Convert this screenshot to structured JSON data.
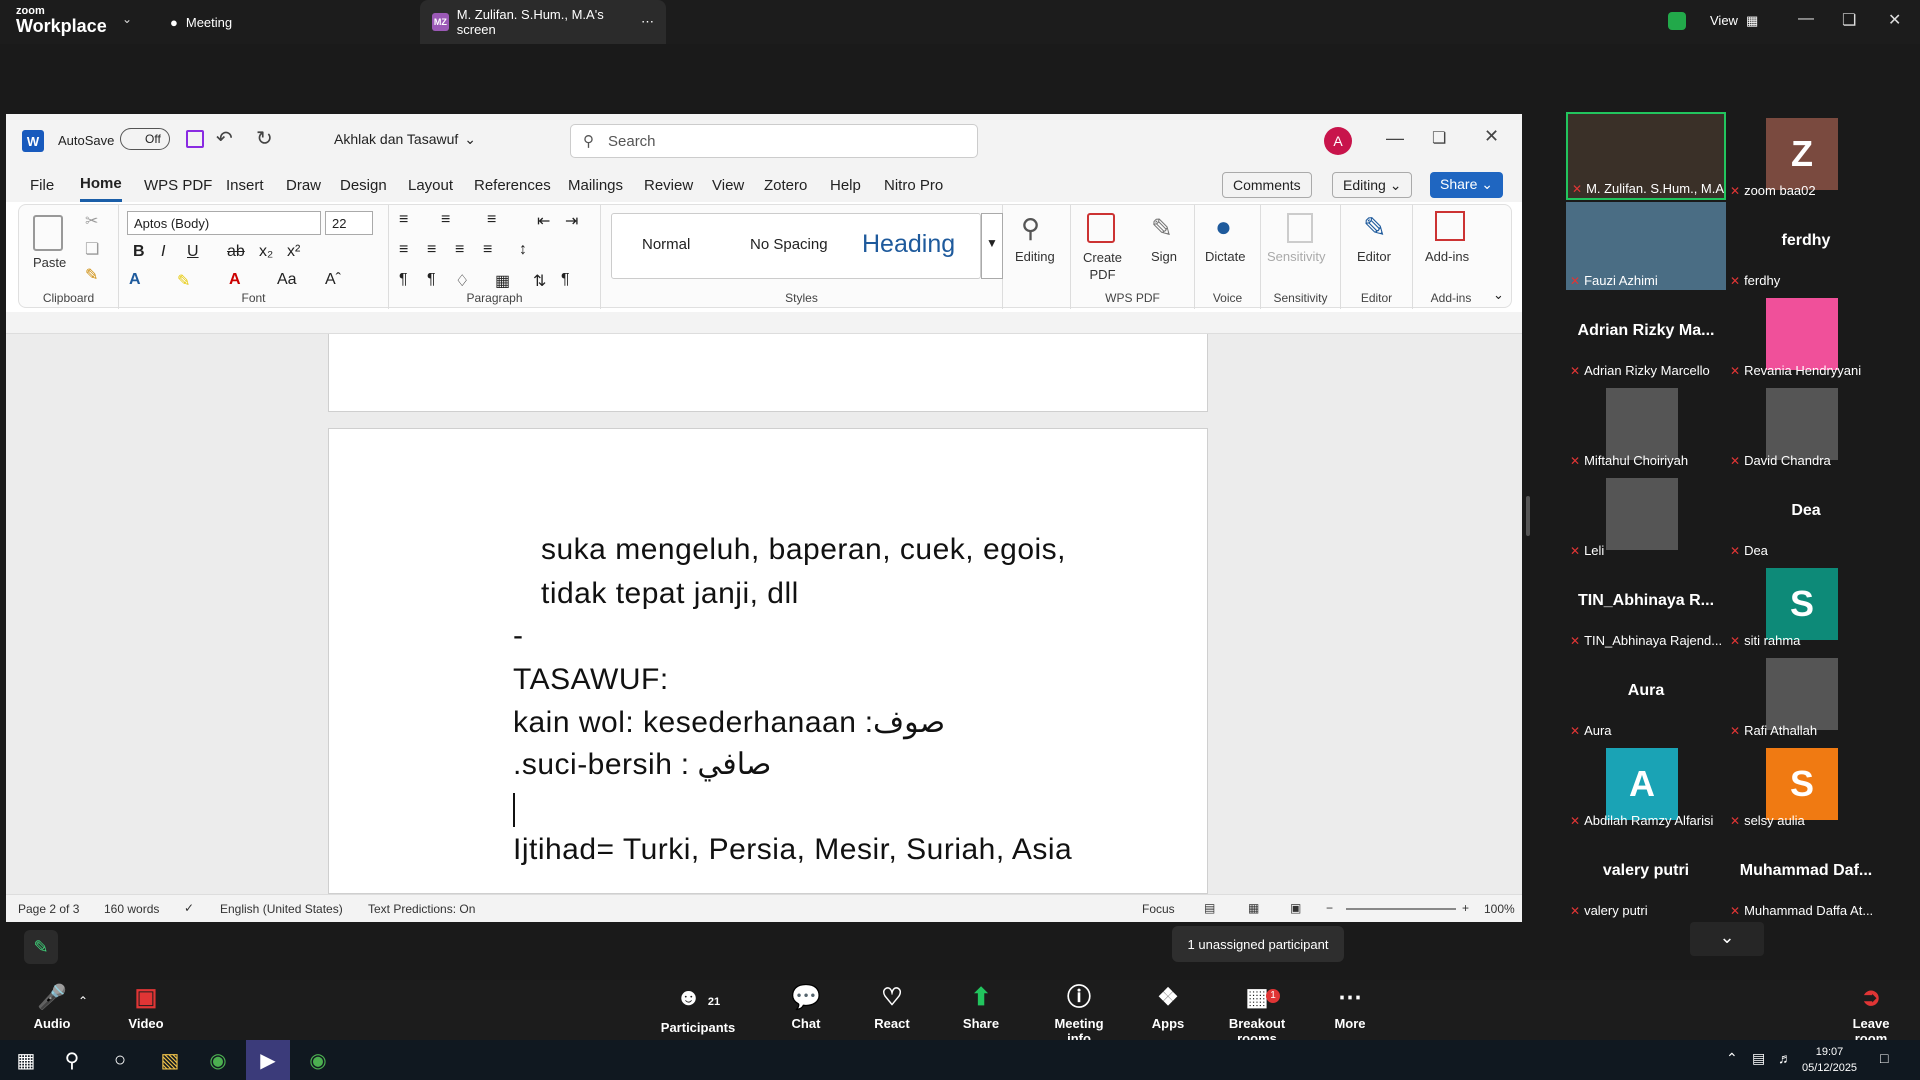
{
  "zoom": {
    "logo_line1": "zoom",
    "logo_line2": "Workplace",
    "meeting_tab": "Meeting",
    "screen_tab_badge": "MZ",
    "screen_tab": "M. Zulifan. S.Hum., M.A's screen",
    "view": "View"
  },
  "word": {
    "autosave": "AutoSave",
    "autosave_state": "Off",
    "doc_title": "Akhlak dan Tasawuf",
    "search_placeholder": "Search",
    "account_initial": "A",
    "tabs": [
      "File",
      "Home",
      "WPS PDF",
      "Insert",
      "Draw",
      "Design",
      "Layout",
      "References",
      "Mailings",
      "Review",
      "View",
      "Zotero",
      "Help",
      "Nitro Pro"
    ],
    "comments": "Comments",
    "editing": "Editing",
    "share": "Share",
    "paste": "Paste",
    "font_name": "Aptos (Body)",
    "font_size": "22",
    "groups": {
      "clipboard": "Clipboard",
      "font": "Font",
      "paragraph": "Paragraph",
      "styles": "Styles",
      "wps": "WPS PDF",
      "voice": "Voice",
      "sensitivity": "Sensitivity",
      "editor": "Editor",
      "addins": "Add-ins"
    },
    "styles": {
      "normal": "Normal",
      "nospacing": "No Spacing",
      "heading": "Heading"
    },
    "buttons": {
      "editing": "Editing",
      "create_pdf_1": "Create",
      "create_pdf_2": "PDF",
      "sign": "Sign",
      "dictate": "Dictate",
      "sensitivity": "Sensitivity",
      "editor": "Editor",
      "addins": "Add-ins"
    },
    "doc_lines": {
      "l1": "suka mengeluh, baperan, cuek, egois,",
      "l2": "tidak tepat janji, dll",
      "l3": "-",
      "l4": "TASAWUF:",
      "l5": "صوف: kain wol: kesederhanaan",
      "l6": "صافي : suci-bersih.",
      "l7": "Ijtihad= Turki, Persia, Mesir, Suriah, Asia"
    },
    "status": {
      "page": "Page 2 of 3",
      "words": "160 words",
      "lang": "English (United States)",
      "predict": "Text Predictions: On",
      "focus": "Focus",
      "zoom": "100%"
    }
  },
  "tooltip": "1 unassigned participant",
  "participants": [
    {
      "name": "M. Zulifan. S.Hum., M.A",
      "label": "",
      "letter": "",
      "color": ""
    },
    {
      "name": "zoom baa02",
      "label": "",
      "letter": "Z",
      "color": "#7a4a3f"
    },
    {
      "name": "Fauzi Azhimi",
      "label": "",
      "letter": "",
      "color": ""
    },
    {
      "name": "ferdhy",
      "label": "ferdhy",
      "letter": "",
      "color": ""
    },
    {
      "name": "Adrian Rizky Marcello",
      "label": "Adrian Rizky Ma...",
      "letter": "",
      "color": ""
    },
    {
      "name": "Revania Hendryyani",
      "label": "",
      "letter": "",
      "color": "#f0509a"
    },
    {
      "name": "Miftahul Choiriyah",
      "label": "",
      "letter": "",
      "color": ""
    },
    {
      "name": "David Chandra",
      "label": "",
      "letter": "",
      "color": ""
    },
    {
      "name": "Leli",
      "label": "",
      "letter": "",
      "color": ""
    },
    {
      "name": "Dea",
      "label": "Dea",
      "letter": "",
      "color": ""
    },
    {
      "name": "TIN_Abhinaya Rajend...",
      "label": "TIN_Abhinaya R...",
      "letter": "",
      "color": ""
    },
    {
      "name": "siti rahma",
      "label": "",
      "letter": "S",
      "color": "#0d8a78"
    },
    {
      "name": "Aura",
      "label": "Aura",
      "letter": "",
      "color": ""
    },
    {
      "name": "Rafi Athallah",
      "label": "",
      "letter": "",
      "color": ""
    },
    {
      "name": "Abdilah Ramzy Alfarisi",
      "label": "",
      "letter": "A",
      "color": "#1aa3b5"
    },
    {
      "name": "selsy aulia",
      "label": "",
      "letter": "S",
      "color": "#f07a12"
    },
    {
      "name": "valery putri",
      "label": "valery putri",
      "letter": "",
      "color": ""
    },
    {
      "name": "Muhammad Daffa At...",
      "label": "Muhammad Daf...",
      "letter": "",
      "color": ""
    }
  ],
  "bottom": {
    "audio": "Audio",
    "video": "Video",
    "participants": "Participants",
    "participants_count": "21",
    "chat": "Chat",
    "react": "React",
    "share": "Share",
    "info": "Meeting info",
    "apps": "Apps",
    "breakout": "Breakout rooms",
    "breakout_badge": "1",
    "more": "More",
    "leave": "Leave room"
  },
  "taskbar": {
    "time": "19:07",
    "date": "05/12/2025"
  }
}
